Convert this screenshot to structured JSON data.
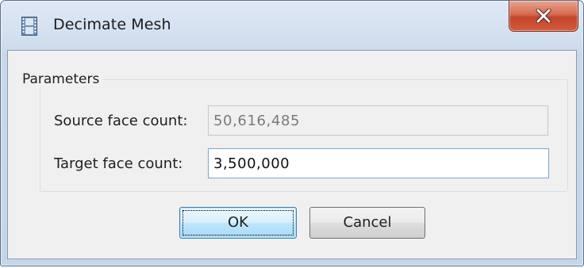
{
  "window": {
    "title": "Decimate Mesh",
    "app_icon": "film-strip-icon",
    "close_icon": "close-x-icon"
  },
  "parameters": {
    "group_title": "Parameters",
    "source_label": "Source face count:",
    "source_value": "50,616,485",
    "target_label": "Target face count:",
    "target_value": "3,500,000"
  },
  "buttons": {
    "ok_label": "OK",
    "cancel_label": "Cancel"
  },
  "colors": {
    "titlebar": "#d4e1f0",
    "close_button": "#c94a30",
    "dialog_background": "#f0f0f0",
    "default_button_accent": "#3c7fb1"
  }
}
